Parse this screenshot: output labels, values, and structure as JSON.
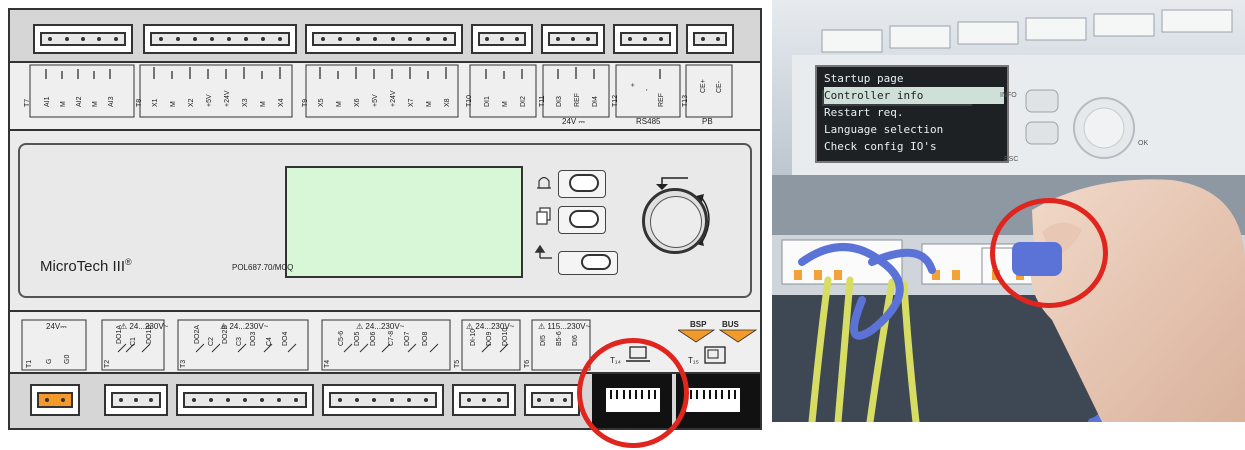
{
  "controller": {
    "brand": "MicroTech III",
    "registered_mark": "®",
    "model": "POL687.70/MCQ",
    "top_terminals": [
      "T7",
      "AI1",
      "M",
      "AI2",
      "M",
      "AI3",
      "T8",
      "X1",
      "M",
      "X2",
      "+5V",
      "+24V",
      "X3",
      "M",
      "X4",
      "T9",
      "X5",
      "M",
      "X6",
      "+5V",
      "+24V",
      "X7",
      "M",
      "X8",
      "T10",
      "DI1",
      "M",
      "DI2",
      "T11",
      "DI3",
      "REF",
      "DI4",
      "T12",
      "+",
      "-",
      "REF",
      "T13",
      "CE+",
      "CE-"
    ],
    "top_groups": {
      "t11_bottom": "24V ⎓",
      "t12_bottom": "RS485",
      "t13_bottom": "PB"
    },
    "bottom_terminals": [
      "T1",
      "G",
      "G0",
      "T2",
      "DO1A",
      "C1",
      "DO1B",
      "T3",
      "DO2A",
      "C2",
      "DO2B",
      "C3",
      "DO3",
      "C4",
      "DO4",
      "T4",
      "C5-6",
      "DO5",
      "DO6",
      "C7-8",
      "DO7",
      "DO8",
      "T5",
      "DI-10",
      "DO9",
      "DO10",
      "T6",
      "DI5",
      "B5-6",
      "DI6"
    ],
    "power_label": "24V⎓",
    "warnings": [
      "24...230V~",
      "24...230V~",
      "24...230V~",
      "24...230V~",
      "115...230V~"
    ],
    "ports": {
      "bsp": "BSP",
      "bus": "BUS",
      "laptop_label": "T₁₄",
      "hmi_label": "T₁₅"
    }
  },
  "photo": {
    "lcd_lines": [
      "Startup page",
      "Controller info",
      "Restart req.",
      "Language selection",
      "Check config IO's"
    ],
    "buttons": [
      "INFO",
      "ESC"
    ],
    "knob_label": "OK"
  },
  "colors": {
    "highlight": "#e0241e",
    "lcd_green": "#d7f7d6",
    "power_connector": "#f39a2b",
    "cable": "#5b73d6",
    "wire_yellow": "#d6dd62"
  },
  "icons": [
    "bell-icon",
    "pages-icon",
    "back-enter-icon",
    "rotate-arrows-icon",
    "laptop-icon",
    "hmi-terminal-icon",
    "warning-triangle-icon"
  ]
}
